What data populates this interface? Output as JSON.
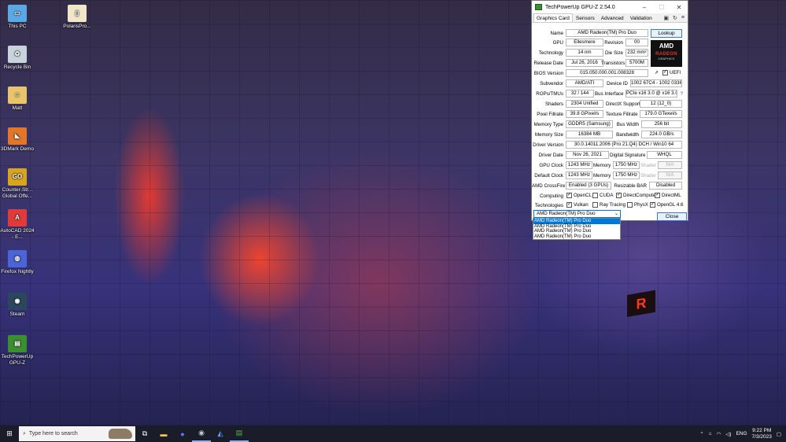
{
  "desktop": {
    "icons": [
      {
        "label": "This PC",
        "icon": "computer-icon",
        "color": "#5aa9e6"
      },
      {
        "label": "PolarisPro...",
        "icon": "file-icon",
        "color": "#f1e7c8"
      },
      {
        "label": "Recycle Bin",
        "icon": "recycle-bin-icon",
        "color": "#c9d3de"
      },
      {
        "label": "Matt",
        "icon": "user-folder-icon",
        "color": "#e9c46a"
      },
      {
        "label": "3DMark Demo",
        "icon": "3dmark-icon",
        "color": "#e2762b"
      },
      {
        "label": "Counter-Str... Global Offe...",
        "icon": "csgo-icon",
        "color": "#d9a520"
      },
      {
        "label": "AutoCAD 2024 - E...",
        "icon": "autocad-icon",
        "color": "#e03b3b"
      },
      {
        "label": "Firefox Nightly",
        "icon": "firefox-icon",
        "color": "#4b64d8"
      },
      {
        "label": "Steam",
        "icon": "steam-icon",
        "color": "#2a475e"
      },
      {
        "label": "TechPowerUp GPU-Z",
        "icon": "gpuz-icon",
        "color": "#3a8f2e"
      }
    ]
  },
  "window": {
    "title": "TechPowerUp GPU-Z 2.54.0",
    "tabs": [
      "Graphics Card",
      "Sensors",
      "Advanced",
      "Validation"
    ],
    "lookup": "Lookup",
    "close": "Close",
    "amd_logo": {
      "top": "AMD",
      "mid": "RADEON",
      "bottom": "GRAPHICS"
    },
    "fields": {
      "name_l": "Name",
      "name": "AMD Radeon(TM) Pro Duo",
      "gpu_l": "GPU",
      "gpu": "Ellesmere",
      "revision_l": "Revision",
      "revision": "00",
      "tech_l": "Technology",
      "tech": "14 nm",
      "diesize_l": "Die Size",
      "diesize": "232 mm²",
      "release_l": "Release Date",
      "release": "Jul 26, 2016",
      "transistors_l": "Transistors",
      "transistors": "5700M",
      "bios_l": "BIOS Version",
      "bios": "015.050.000.001.008328",
      "uefi": "UEFI",
      "subvendor_l": "Subvendor",
      "subvendor": "AMD/ATI",
      "deviceid_l": "Device ID",
      "deviceid": "1002 67C4 - 1002 0336",
      "rops_l": "ROPs/TMUs",
      "rops": "32 / 144",
      "bus_l": "Bus Interface",
      "bus": "PCIe x16 3.0 @ x16 3.0",
      "help": "?",
      "shaders_l": "Shaders",
      "shaders": "2304 Unified",
      "dx_l": "DirectX Support",
      "dx": "12 (12_0)",
      "pixel_l": "Pixel Fillrate",
      "pixel": "39.8 GPixel/s",
      "texture_l": "Texture Fillrate",
      "texture": "179.0 GTexel/s",
      "memtype_l": "Memory Type",
      "memtype": "GDDR5 (Samsung)",
      "buswidth_l": "Bus Width",
      "buswidth": "256 bit",
      "memsize_l": "Memory Size",
      "memsize": "16384 MB",
      "bandwidth_l": "Bandwidth",
      "bandwidth": "224.0 GB/s",
      "driver_l": "Driver Version",
      "driver": "30.0.14011.2006 (Pro 21.Q4) DCH / Win10 64",
      "driverdate_l": "Driver Date",
      "driverdate": "Nov 26, 2021",
      "sig_l": "Digital Signature",
      "sig": "WHQL",
      "gpuclock_l": "GPU Clock",
      "gpuclock": "1243 MHz",
      "memory_l": "Memory",
      "mem1": "1750 MHz",
      "shader_l": "Shader",
      "shader1": "N/A",
      "defclock_l": "Default Clock",
      "defclock": "1243 MHz",
      "mem2": "1750 MHz",
      "shader2": "N/A",
      "crossfire_l": "AMD CrossFire",
      "crossfire": "Enabled (3 GPUs)",
      "rebar_l": "Resizable BAR",
      "rebar": "Disabled",
      "computing_l": "Computing",
      "technologies_l": "Technologies"
    },
    "computing": [
      {
        "label": "OpenCL",
        "checked": true
      },
      {
        "label": "CUDA",
        "checked": false
      },
      {
        "label": "DirectCompute",
        "checked": true
      },
      {
        "label": "DirectML",
        "checked": true
      }
    ],
    "technologies": [
      {
        "label": "Vulkan",
        "checked": true
      },
      {
        "label": "Ray Tracing",
        "checked": false
      },
      {
        "label": "PhysX",
        "checked": false
      },
      {
        "label": "OpenGL 4.6",
        "checked": true
      }
    ],
    "gpu_select": {
      "selected": "AMD Radeon(TM) Pro Duo",
      "options": [
        "AMD Radeon(TM) Pro Duo",
        "AMD Radeon(TM) Pro Duo",
        "AMD Radeon(TM) Pro Duo",
        "AMD Radeon(TM) Pro Duo"
      ]
    }
  },
  "taskbar": {
    "search_placeholder": "Type here to search",
    "language": "ENG",
    "time": "9:22 PM",
    "date": "7/3/2023"
  }
}
